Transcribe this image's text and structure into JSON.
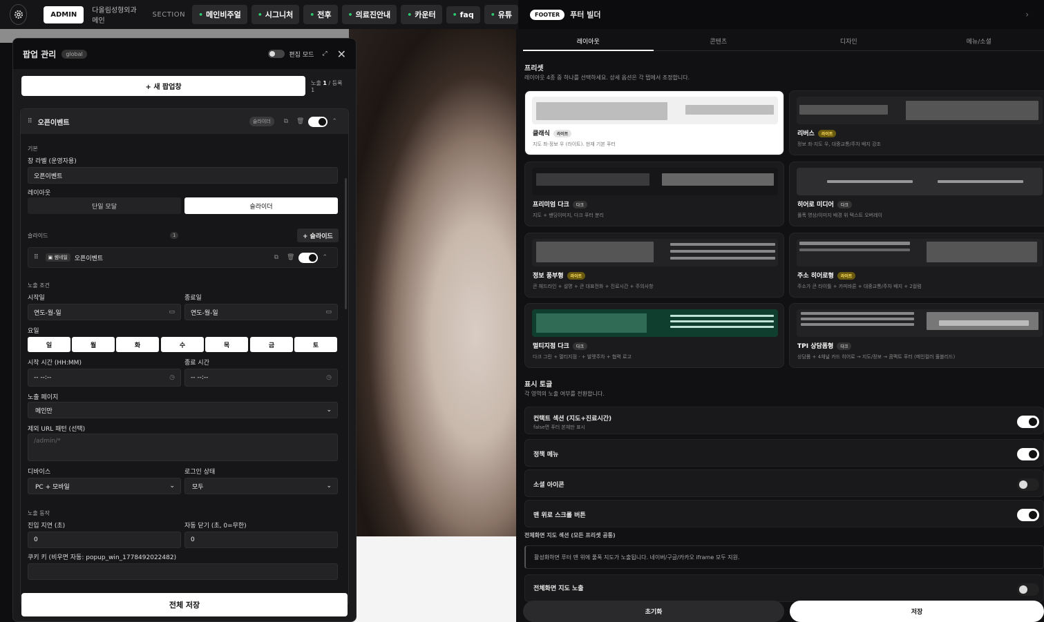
{
  "topbar": {
    "admin": "ADMIN",
    "site": "다올림성형외과 메인",
    "section": "SECTION",
    "chips": [
      "메인비주얼",
      "시그니처",
      "전후",
      "의료진안내",
      "카운터",
      "faq",
      "유튜"
    ]
  },
  "popup": {
    "title": "팝업 관리",
    "scope": "global",
    "edit_mode": "편집 모드",
    "new_button": "+ 새 팝업창",
    "count_label": "노출",
    "count_shown": "1",
    "count_sep": "/ 등록 1",
    "card": {
      "name": "오픈이벤트",
      "badge": "슬라이더",
      "basic_section": "기본",
      "window_label_lbl": "창 라벨 (운영자용)",
      "window_label": "오픈이벤트",
      "layout_lbl": "레이아웃",
      "layout_single": "단일 모달",
      "layout_slider": "슬라이더",
      "slides_lbl": "슬라이드",
      "slides_count": "1",
      "add_slide": "+ 슬라이드",
      "slide_type": "썸네일",
      "slide_name": "오픈이벤트",
      "cond_lbl": "노출 조건",
      "start_lbl": "시작일",
      "start_val": "연도-월-일",
      "end_lbl": "종료일",
      "end_val": "연도-월-일",
      "day_lbl": "요일",
      "days": [
        "일",
        "월",
        "화",
        "수",
        "목",
        "금",
        "토"
      ],
      "start_time_lbl": "시작 시간 (HH:MM)",
      "start_time": "-- --:--",
      "end_time_lbl": "종료 시간",
      "end_time": "-- --:--",
      "page_lbl": "노출 페이지",
      "page_val": "메인만",
      "exclude_lbl": "제외 URL 패턴 (선택)",
      "exclude_ph": "/admin/*",
      "device_lbl": "디바이스",
      "device_val": "PC + 모바일",
      "login_lbl": "로그인 상태",
      "login_val": "모두",
      "action_lbl": "노출 동작",
      "delay_lbl": "진입 지연 (초)",
      "delay_val": "0",
      "autoclose_lbl": "자동 닫기 (초, 0=무한)",
      "autoclose_val": "0",
      "cookie_lbl": "쿠키 키 (비우면 자동: popup_win_1778492022482)"
    },
    "save_all": "전체 저장"
  },
  "footer": {
    "badge": "FOOTER",
    "title": "푸터 빌더",
    "tabs": [
      "레이아웃",
      "콘텐츠",
      "디자인",
      "메뉴/소셜"
    ],
    "preset_title": "프리셋",
    "preset_desc": "레이아웃 4종 중 하나를 선택하세요. 상세 옵션은 각 탭에서 조정합니다.",
    "presets": [
      {
        "name": "클래식",
        "badge": "라이트",
        "desc": "지도 좌·정보 우 (라이트). 현재 기본 푸터"
      },
      {
        "name": "리버스",
        "badge": "라이트",
        "desc": "정보 좌·지도 우, 대중교통/주차 배지 강조"
      },
      {
        "name": "프리미엄 다크",
        "badge": "다크",
        "desc": "지도 + 밴딩이미지, 다크 푸터 분리"
      },
      {
        "name": "히어로 미디어",
        "badge": "다크",
        "desc": "풀폭 영상/이미지 배경 위 텍스트 오버레이"
      },
      {
        "name": "정보 풍부형",
        "badge": "라이트",
        "desc": "큰 헤드라인 + 설명 + 큰 대표전화 + 진료시간 + 주의사항"
      },
      {
        "name": "주소 히어로형",
        "badge": "라이트",
        "desc": "주소가 큰 타이틀 + 카피바른 + 대중교통/주차 배지 + 2컬럼"
      },
      {
        "name": "멀티지점 다크",
        "badge": "다크",
        "desc": "다크 그린 + 멀티지점 · + 발렛주차 + 협력 로고"
      },
      {
        "name": "TPI 상담폼형",
        "badge": "다크",
        "desc": "상담폼 + 4채널 카드 히어로 → 지도/정보 → 콤팩트 푸터 (메인컬러 풀블리드)"
      }
    ],
    "toggle_title": "표시 토글",
    "toggle_desc": "각 영역의 노출 여부를 전환합니다.",
    "toggles": [
      {
        "name": "컨택트 섹션 (지도+진료시간)",
        "sub": "false면 푸터 본체만 표시",
        "on": true
      },
      {
        "name": "정책 메뉴",
        "on": true
      },
      {
        "name": "소셜 아이콘",
        "on": false
      },
      {
        "name": "맨 위로 스크롤 버튼",
        "on": true
      }
    ],
    "map_section": "전체화면 지도 섹션 (모든 프리셋 공통)",
    "map_info": "활성화하면 푸터 맨 위에 풀폭 지도가 노출됩니다. 네이버/구글/카카오 iframe 모두 지원.",
    "map_toggle": "전체화면 지도 노출",
    "reset": "초기화",
    "save": "저장"
  }
}
